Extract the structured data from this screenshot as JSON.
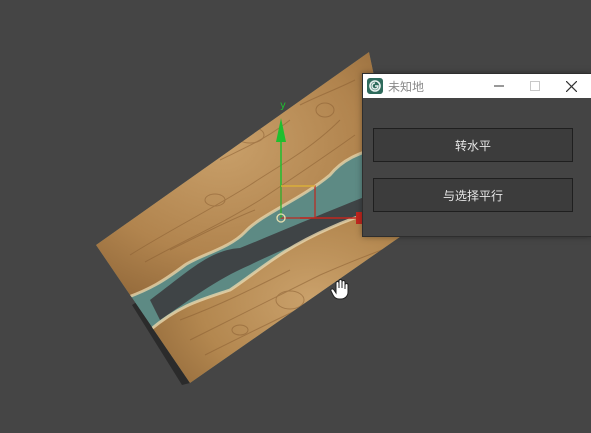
{
  "dialog": {
    "title": "未知地",
    "buttons": {
      "horizontal_label": "转水平",
      "parallel_label": "与选择平行"
    },
    "window_controls": [
      "minimize-icon",
      "maximize-icon",
      "close-icon"
    ]
  },
  "viewport": {
    "background": "#454545",
    "gizmo_axis_label": "y",
    "cursor": "hand-pan-icon",
    "colors": {
      "wood": "#b88a52",
      "resin": "#6c9a94",
      "gizmo_y": "#1fbf2f",
      "gizmo_x": "#c0261e"
    }
  }
}
